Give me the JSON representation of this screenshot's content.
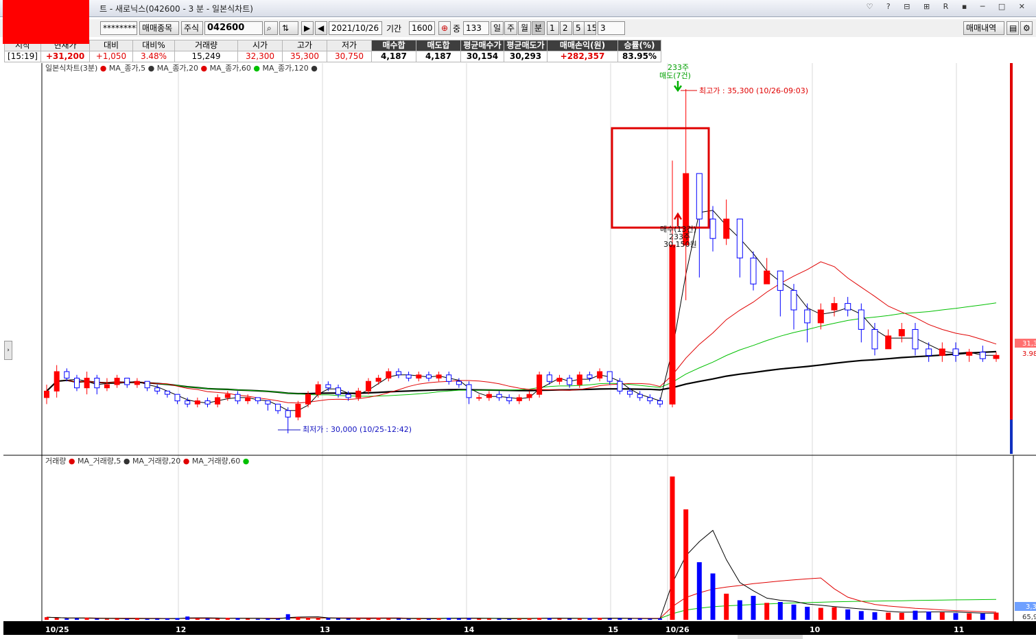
{
  "window": {
    "title": "트 - 새로닉스(042600 - 3 분 - 일본식차트)",
    "icons": "♡ ? ⊟ ⊞ R ▪ ─ □ ✕"
  },
  "toolbar": {
    "password_mask": "*********",
    "trade_item_btn": "매매종목",
    "market_label": "주식",
    "code": "042600",
    "date": "2021/10/26",
    "period_label": "기간",
    "period_value": "1600",
    "mid_label": "중",
    "mid_value": "133",
    "units": [
      "일",
      "주",
      "월",
      "분",
      "1",
      "2",
      "5",
      "15"
    ],
    "interval": "3",
    "history_btn": "매매내역"
  },
  "info": {
    "headers": [
      "시작",
      "현재가",
      "대비",
      "대비%",
      "거래량",
      "시가",
      "고가",
      "저가",
      "매수합",
      "매도합",
      "평균매수가",
      "평균매도가",
      "매매손익(원)",
      "승률(%)"
    ],
    "values": [
      "[15:19]",
      "+31,200",
      "+1,050",
      "3.48%",
      "15,249",
      "32,300",
      "35,300",
      "30,750",
      "4,187",
      "4,187",
      "30,154",
      "30,293",
      "+282,357",
      "83.95%"
    ]
  },
  "price_panel": {
    "legend": [
      "일본식차트(3분)",
      "MA_종가,5",
      "MA_종가,20",
      "MA_종가,60",
      "MA_종가,120"
    ],
    "high_label": "최고가 : 35,300 (10/26-09:03)",
    "low_label": "최저가 : 30,000 (10/25-12:42)",
    "sell_marker": {
      "qty": "233주",
      "text": "매도(7건)"
    },
    "buy_marker": {
      "text": "매수(13건)",
      "qty": "233주",
      "price": "30,150원"
    },
    "right_price": "31,3",
    "right_pct": "3.98"
  },
  "volume_panel": {
    "legend": [
      "거래량",
      "MA_거래량,5",
      "MA_거래량,20",
      "MA_거래량,60"
    ],
    "right_a": "3,3",
    "right_b": "65,9"
  },
  "x_axis_labels": [
    "10/25",
    "12",
    "13",
    "14",
    "15",
    "10/26",
    "10",
    "11"
  ],
  "colors": {
    "up": "#ff0000",
    "down": "#0000ff",
    "ma5": "#000000",
    "ma20": "#e00000",
    "ma60": "#00c000",
    "ma120": "#000000",
    "highlight": "#e00000",
    "buy_arrow": "#e00000",
    "sell_arrow": "#00b000"
  },
  "chart_data": {
    "type": "candlestick",
    "interval": "3분",
    "y_range_approx": [
      29800,
      35500
    ],
    "high": {
      "price": 35300,
      "time": "10/26-09:03"
    },
    "low": {
      "price": 30000,
      "time": "10/25-12:42"
    },
    "current": 31200,
    "series_names": [
      "MA_종가,5",
      "MA_종가,20",
      "MA_종가,60",
      "MA_종가,120"
    ],
    "candles": [
      [
        30550,
        30650,
        30750,
        30450
      ],
      [
        30650,
        30950,
        31050,
        30550
      ],
      [
        30950,
        30850,
        31000,
        30800
      ],
      [
        30850,
        30700,
        30900,
        30650
      ],
      [
        30700,
        30850,
        30950,
        30600
      ],
      [
        30850,
        30700,
        30900,
        30600
      ],
      [
        30700,
        30750,
        30850,
        30650
      ],
      [
        30750,
        30850,
        30900,
        30700
      ],
      [
        30850,
        30750,
        30850,
        30700
      ],
      [
        30750,
        30800,
        30850,
        30700
      ],
      [
        30800,
        30700,
        30800,
        30650
      ],
      [
        30700,
        30650,
        30750,
        30600
      ],
      [
        30650,
        30600,
        30650,
        30550
      ],
      [
        30600,
        30500,
        30600,
        30450
      ],
      [
        30500,
        30450,
        30550,
        30400
      ],
      [
        30450,
        30500,
        30550,
        30400
      ],
      [
        30500,
        30450,
        30550,
        30400
      ],
      [
        30450,
        30550,
        30600,
        30400
      ],
      [
        30550,
        30600,
        30650,
        30500
      ],
      [
        30600,
        30500,
        30650,
        30450
      ],
      [
        30500,
        30550,
        30600,
        30450
      ],
      [
        30550,
        30500,
        30550,
        30450
      ],
      [
        30500,
        30450,
        30500,
        30350
      ],
      [
        30450,
        30350,
        30450,
        30300
      ],
      [
        30350,
        30250,
        30400,
        30000
      ],
      [
        30250,
        30450,
        30500,
        30200
      ],
      [
        30450,
        30600,
        30650,
        30400
      ],
      [
        30600,
        30750,
        30800,
        30550
      ],
      [
        30750,
        30700,
        30800,
        30650
      ],
      [
        30700,
        30600,
        30750,
        30550
      ],
      [
        30600,
        30550,
        30650,
        30500
      ],
      [
        30550,
        30650,
        30700,
        30500
      ],
      [
        30650,
        30800,
        30850,
        30600
      ],
      [
        30800,
        30850,
        30900,
        30750
      ],
      [
        30850,
        30950,
        31000,
        30800
      ],
      [
        30950,
        30900,
        31000,
        30850
      ],
      [
        30900,
        30850,
        30950,
        30800
      ],
      [
        30850,
        30900,
        30950,
        30800
      ],
      [
        30900,
        30850,
        30950,
        30800
      ],
      [
        30850,
        30900,
        30950,
        30800
      ],
      [
        30900,
        30800,
        30950,
        30750
      ],
      [
        30800,
        30750,
        30850,
        30700
      ],
      [
        30750,
        30550,
        30800,
        30450
      ],
      [
        30550,
        30550,
        30600,
        30500
      ],
      [
        30550,
        30600,
        30650,
        30500
      ],
      [
        30600,
        30550,
        30650,
        30500
      ],
      [
        30550,
        30500,
        30600,
        30450
      ],
      [
        30500,
        30550,
        30600,
        30450
      ],
      [
        30550,
        30600,
        30650,
        30500
      ],
      [
        30600,
        30900,
        30950,
        30550
      ],
      [
        30900,
        30800,
        30950,
        30750
      ],
      [
        30800,
        30850,
        30900,
        30750
      ],
      [
        30850,
        30750,
        30900,
        30700
      ],
      [
        30750,
        30900,
        30950,
        30700
      ],
      [
        30900,
        30850,
        30950,
        30800
      ],
      [
        30850,
        30950,
        31000,
        30800
      ],
      [
        30950,
        30800,
        30950,
        30750
      ],
      [
        30800,
        30650,
        30850,
        30600
      ],
      [
        30650,
        30600,
        30700,
        30550
      ],
      [
        30600,
        30550,
        30650,
        30500
      ],
      [
        30550,
        30500,
        30600,
        30450
      ],
      [
        30500,
        30450,
        30550,
        30400
      ],
      [
        30450,
        32900,
        34200,
        30400
      ],
      [
        32900,
        34000,
        35300,
        32050
      ],
      [
        34000,
        33300,
        33700,
        32400
      ],
      [
        33300,
        33000,
        33500,
        32800
      ],
      [
        33000,
        33300,
        33600,
        32900
      ],
      [
        33300,
        32700,
        33300,
        32400
      ],
      [
        32700,
        32300,
        32800,
        32200
      ],
      [
        32300,
        32500,
        32700,
        32300
      ],
      [
        32500,
        32200,
        32500,
        31800
      ],
      [
        32200,
        31900,
        32300,
        31600
      ],
      [
        31900,
        31700,
        32000,
        31400
      ],
      [
        31700,
        31900,
        32000,
        31600
      ],
      [
        31900,
        32000,
        32100,
        31800
      ],
      [
        32000,
        31900,
        32100,
        31800
      ],
      [
        31900,
        31600,
        32000,
        31400
      ],
      [
        31600,
        31300,
        31700,
        31200
      ],
      [
        31300,
        31500,
        31600,
        31300
      ],
      [
        31500,
        31600,
        31700,
        31400
      ],
      [
        31600,
        31300,
        31700,
        31200
      ],
      [
        31300,
        31200,
        31400,
        31100
      ],
      [
        31200,
        31300,
        31400,
        31100
      ],
      [
        31300,
        31200,
        31400,
        31100
      ],
      [
        31200,
        31250,
        31300,
        31100
      ],
      [
        31250,
        31150,
        31350,
        31100
      ],
      [
        31150,
        31200,
        31250,
        31100
      ]
    ],
    "volume_y_range": [
      0,
      70000
    ],
    "volume": [
      1200,
      800,
      600,
      700,
      900,
      500,
      400,
      600,
      500,
      700,
      400,
      500,
      600,
      800,
      1500,
      700,
      600,
      500,
      900,
      800,
      500,
      400,
      600,
      500,
      2600,
      1300,
      900,
      700,
      800,
      600,
      500,
      700,
      600,
      800,
      700,
      500,
      400,
      600,
      500,
      700,
      900,
      700,
      800,
      500,
      600,
      500,
      400,
      600,
      700,
      900,
      800,
      600,
      500,
      700,
      800,
      900,
      600,
      700,
      500,
      600,
      500,
      600,
      65900,
      50800,
      26500,
      21300,
      12000,
      9000,
      11000,
      7800,
      8200,
      7000,
      6000,
      5500,
      5800,
      4800,
      4000,
      3500,
      3300,
      3200,
      4200,
      3800,
      3400,
      3100,
      3000,
      2900,
      3300
    ]
  },
  "highlight_box_label": ""
}
